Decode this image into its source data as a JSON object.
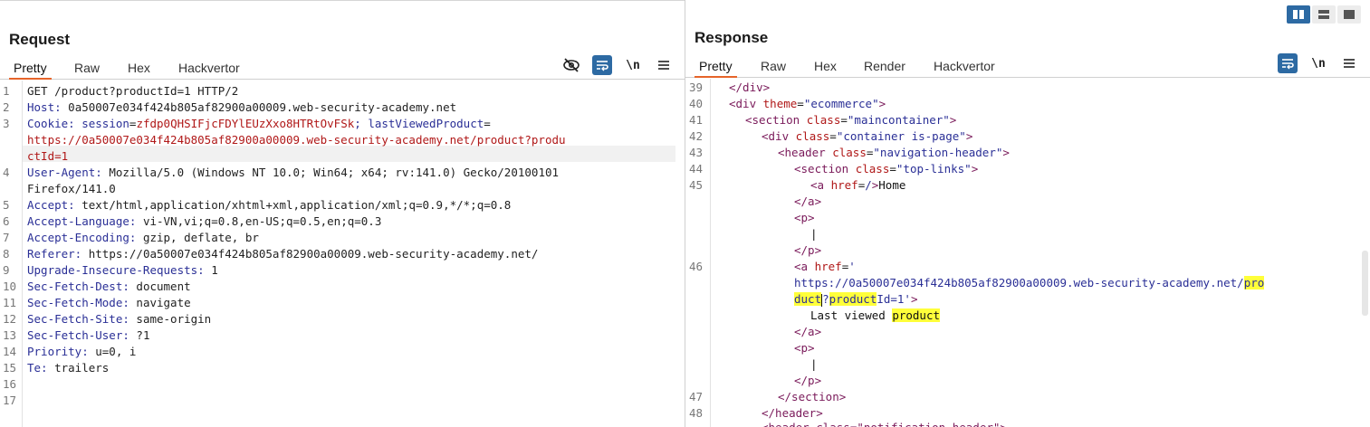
{
  "colors": {
    "accent": "#e6642a",
    "toolbar_active": "#2d6aa3",
    "highlight": "#ffff3a"
  },
  "layout_toggle": {
    "icons": [
      "split-vertical-icon",
      "split-horizontal-icon",
      "single-pane-icon"
    ]
  },
  "request": {
    "title": "Request",
    "tabs": [
      "Pretty",
      "Raw",
      "Hex",
      "Hackvertor"
    ],
    "active_tab": "Pretty",
    "toolbar_icons": [
      "eye-off-icon",
      "word-wrap-icon",
      "newline-icon",
      "menu-icon"
    ],
    "newline_label": "\\n",
    "line_numbers": [
      "1",
      "2",
      "3",
      "",
      "",
      "4",
      "",
      "5",
      "6",
      "7",
      "8",
      "9",
      "10",
      "11",
      "12",
      "13",
      "14",
      "15",
      "16",
      "17"
    ],
    "lines": {
      "l1": "GET /product?productId=1 HTTP/2",
      "l2_name": "Host:",
      "l2_val": " 0a50007e034f424b805af82900a00009.web-security-academy.net",
      "l3_name": "Cookie:",
      "l3_sep1": " session",
      "l3_val1": "zfdp0QHSIFjcFDYlEUzXxo8HTRtOvFSk",
      "l3_sep2": "; lastViewedProduct",
      "l3_val2a": "https://0a50007e034f424b805af82900a00009.web-security-academy.net/product?produ",
      "l3_val2b": "ctId=1",
      "l4_name": "User-Agent:",
      "l4_val_a": " Mozilla/5.0 (Windows NT 10.0; Win64; x64; rv:141.0) Gecko/20100101",
      "l4_val_b": "Firefox/141.0",
      "l5_name": "Accept:",
      "l5_val": " text/html,application/xhtml+xml,application/xml;q=0.9,*/*;q=0.8",
      "l6_name": "Accept-Language:",
      "l6_val": " vi-VN,vi;q=0.8,en-US;q=0.5,en;q=0.3",
      "l7_name": "Accept-Encoding:",
      "l7_val": " gzip, deflate, br",
      "l8_name": "Referer:",
      "l8_val": " https://0a50007e034f424b805af82900a00009.web-security-academy.net/",
      "l9_name": "Upgrade-Insecure-Requests:",
      "l9_val": " 1",
      "l10_name": "Sec-Fetch-Dest:",
      "l10_val": " document",
      "l11_name": "Sec-Fetch-Mode:",
      "l11_val": " navigate",
      "l12_name": "Sec-Fetch-Site:",
      "l12_val": " same-origin",
      "l13_name": "Sec-Fetch-User:",
      "l13_val": " ?1",
      "l14_name": "Priority:",
      "l14_val": " u=0, i",
      "l15_name": "Te:",
      "l15_val": " trailers"
    }
  },
  "response": {
    "title": "Response",
    "tabs": [
      "Pretty",
      "Raw",
      "Hex",
      "Render",
      "Hackvertor"
    ],
    "active_tab": "Pretty",
    "toolbar_icons": [
      "word-wrap-icon",
      "newline-icon",
      "menu-icon"
    ],
    "newline_label": "\\n",
    "line_numbers": [
      "39",
      "40",
      "41",
      "42",
      "43",
      "44",
      "45",
      "",
      "",
      "",
      "",
      "",
      "46",
      "",
      "",
      "",
      "",
      "",
      "",
      "",
      "47",
      "48"
    ],
    "code": {
      "l39": "</div>",
      "l40_tag": "<div ",
      "l40_attr": "theme",
      "l40_eq": "=",
      "l40_str": "\"ecommerce\"",
      "l40_end": ">",
      "l41_tag": "<section ",
      "l41_attr": "class",
      "l41_eq": "=",
      "l41_str": "\"maincontainer\"",
      "l41_end": ">",
      "l42_tag": "<div ",
      "l42_attr": "class",
      "l42_eq": "=",
      "l42_str": "\"container is-page\"",
      "l42_end": ">",
      "l43_tag": "<header ",
      "l43_attr": "class",
      "l43_eq": "=",
      "l43_str": "\"navigation-header\"",
      "l43_end": ">",
      "l44_tag": "<section ",
      "l44_attr": "class",
      "l44_eq": "=",
      "l44_str": "\"top-links\"",
      "l44_end": ">",
      "l45_tag": "<a ",
      "l45_attr": "href",
      "l45_eq": "=",
      "l45_str": "/",
      "l45_end": ">",
      "l45_text": "Home",
      "close_a": "</a>",
      "open_p": "<p>",
      "pipe": "|",
      "close_p": "</p>",
      "l46_tag": "<a ",
      "l46_attr": "href",
      "l46_eq": "=",
      "l46_q": "'",
      "l46_url_a": "https://0a50007e034f424b805af82900a00009.web-security-academy.net/",
      "l46_hl1": "pro",
      "l46_hl2": "duct",
      "l46_q2": "?",
      "l46_hl3": "product",
      "l46_rest": "Id=1'",
      "l46_end": ">",
      "l46_text1": "Last viewed ",
      "l46_text2": "product",
      "l47": "</section>",
      "l48": "</header>",
      "l49_partial": "<header class=\"notification-header\">"
    }
  }
}
